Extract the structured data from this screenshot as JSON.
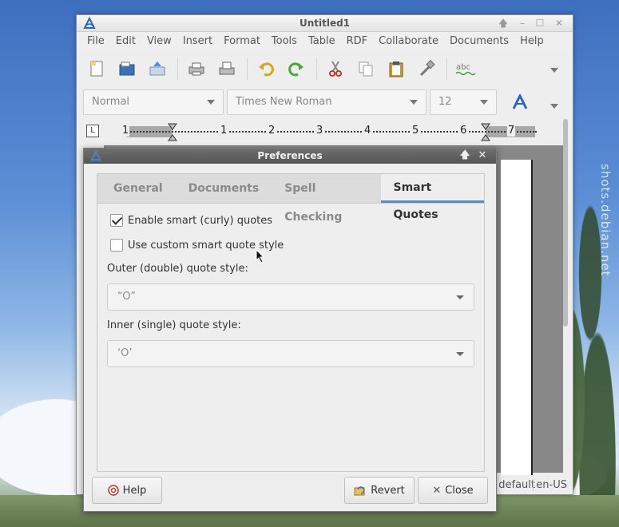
{
  "desktop": {
    "watermark": "shots.debian.net"
  },
  "window": {
    "title": "Untitled1",
    "menu": [
      "File",
      "Edit",
      "View",
      "Insert",
      "Format",
      "Tools",
      "Table",
      "RDF",
      "Collaborate",
      "Documents",
      "Help"
    ],
    "format": {
      "style": "Normal",
      "font": "Times New Roman",
      "size": "12"
    },
    "ruler": {
      "numbers": [
        "1",
        "1",
        "2",
        "3",
        "4",
        "5",
        "6",
        "7"
      ]
    },
    "status": {
      "language_default": "default",
      "locale": "en-US"
    }
  },
  "dialog": {
    "title": "Preferences",
    "tabs": [
      {
        "label": "General"
      },
      {
        "label": "Documents"
      },
      {
        "label": "Spell Checking"
      },
      {
        "label": "Smart Quotes",
        "active": true
      }
    ],
    "smart_quotes": {
      "enable_label": "Enable smart (curly) quotes",
      "enable_checked": true,
      "custom_label": "Use custom smart quote style",
      "custom_checked": false,
      "outer_label": "Outer (double) quote style:",
      "outer_value": "“O”",
      "inner_label": "Inner (single) quote style:",
      "inner_value": "‘O’"
    },
    "buttons": {
      "help": "Help",
      "revert": "Revert",
      "close": "Close"
    }
  },
  "colors": {
    "accent": "#4a90d9",
    "dialog_title_bg": "#5f5f5f"
  }
}
